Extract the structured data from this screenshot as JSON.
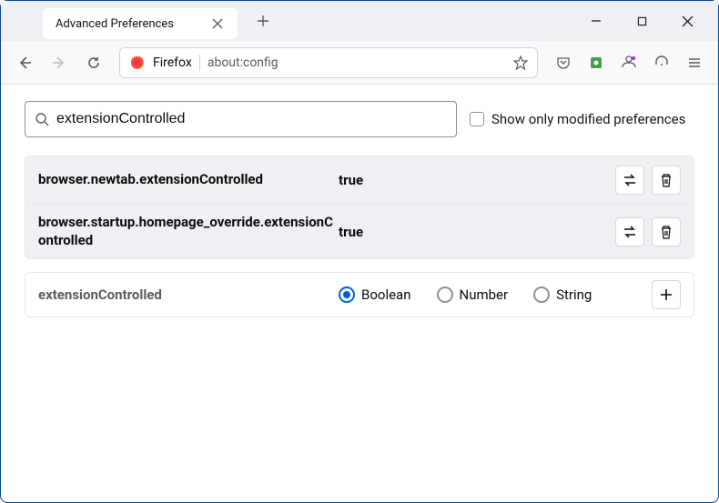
{
  "window": {
    "tab_title": "Advanced Preferences"
  },
  "urlbar": {
    "brand": "Firefox",
    "url": "about:config"
  },
  "search": {
    "value": "extensionControlled",
    "checkbox_label": "Show only modified preferences"
  },
  "prefs": [
    {
      "key": "browser.newtab.extensionControlled",
      "value": "true"
    },
    {
      "key": "browser.startup.homepage_override.extensionControlled",
      "value": "true"
    }
  ],
  "newpref": {
    "name": "extensionControlled",
    "types": {
      "boolean": "Boolean",
      "number": "Number",
      "string": "String"
    }
  }
}
